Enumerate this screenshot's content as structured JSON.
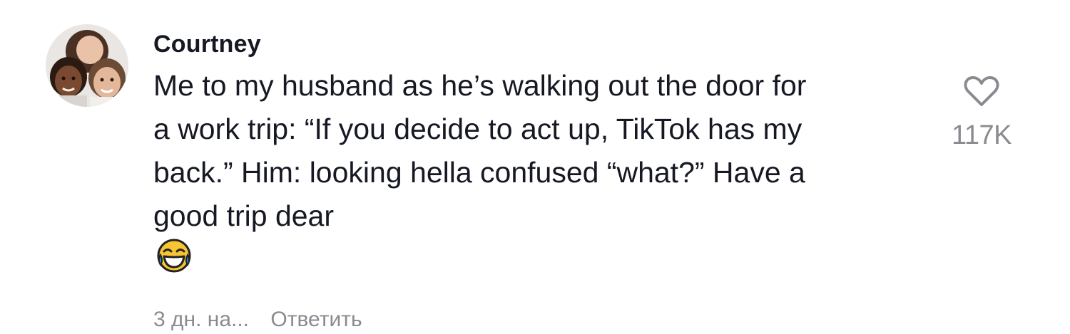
{
  "comment": {
    "username": "Courtney",
    "text_lines": [
      "Me to my husband as he’s walking out the door for",
      "a work trip: “If you decide to act up, TikTok has my",
      "back.” Him: looking hella confused “what?” Have a",
      "good trip dear"
    ],
    "emoji": "face-with-tears-of-joy",
    "timestamp": "3 дн. на...",
    "reply_label": "Ответить",
    "like_count": "117K",
    "like_icon": "heart-outline-icon"
  },
  "colors": {
    "text": "#161823",
    "muted": "#8a8b91",
    "background": "#ffffff"
  }
}
